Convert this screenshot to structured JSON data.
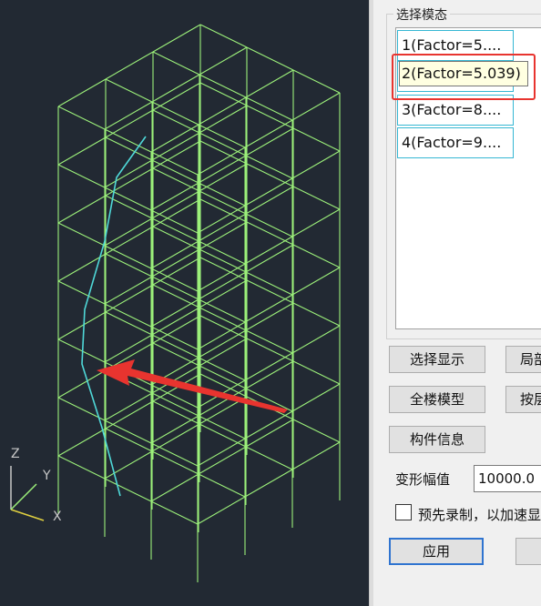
{
  "panel": {
    "group_title": "选择模态",
    "modes": [
      {
        "label": "1(Factor=5...."
      },
      {
        "label": "2(Factor=5.039)"
      },
      {
        "label": "3(Factor=8...."
      },
      {
        "label": "4(Factor=9...."
      }
    ],
    "tooltip": "2(Factor=5.039)",
    "buttons": {
      "select_display": "选择显示",
      "local": "局部",
      "whole_model": "全楼模型",
      "by_floor": "按层",
      "member_info": "构件信息",
      "apply": "应用",
      "other": ""
    },
    "deform_label": "变形幅值",
    "deform_value": "10000.0",
    "prerecord_label": "预先录制，以加速显示",
    "prerecord_checked": false
  },
  "viewport": {
    "axes": {
      "z": "Z",
      "y": "Y",
      "x": "X"
    },
    "colors": {
      "background": "#222933",
      "frame": "#9cf07a",
      "mode_shape": "#4fd8d8",
      "arrow": "#e8342f",
      "axis_x": "#e0d040",
      "axis_y": "#9cf07a",
      "axis_z": "#c8c8c8"
    }
  }
}
